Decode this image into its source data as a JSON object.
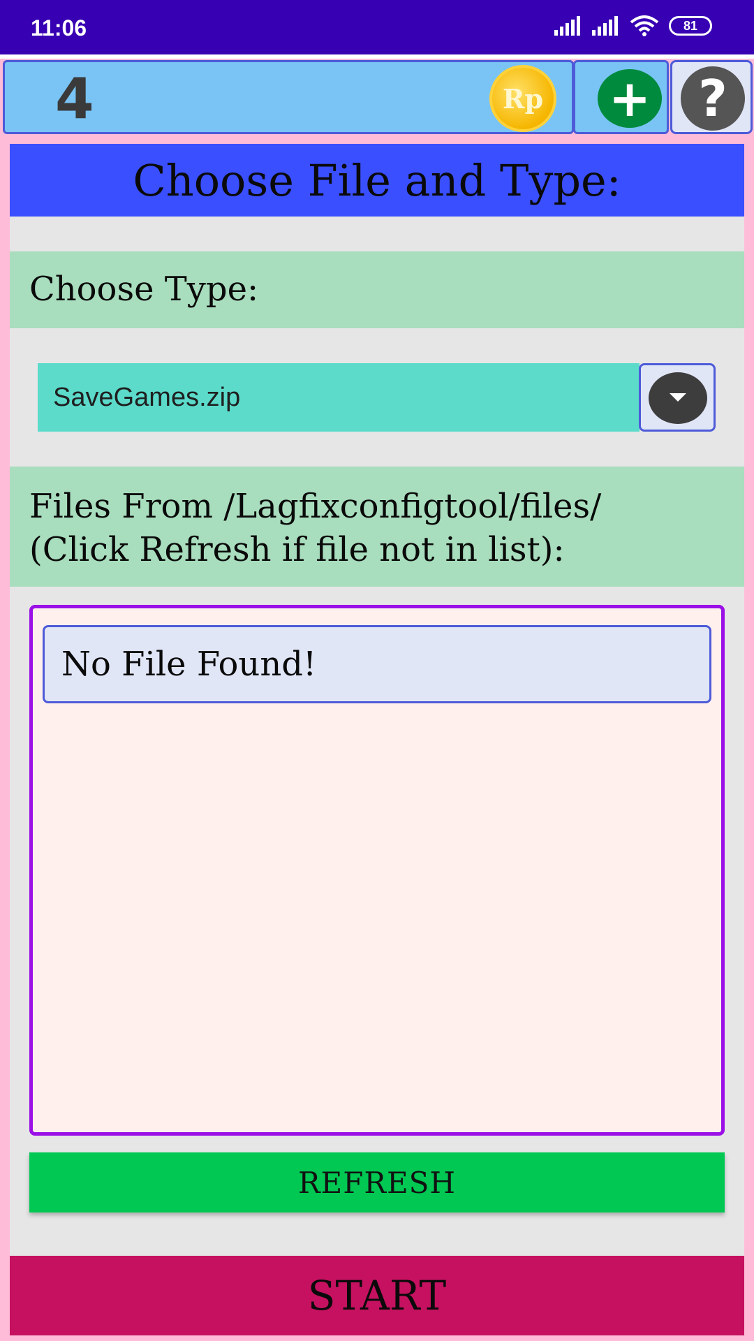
{
  "status_bar": {
    "time": "11:06",
    "battery": "81",
    "icons": [
      "signal-icon",
      "signal-icon",
      "wifi-icon",
      "battery-icon"
    ]
  },
  "topbar": {
    "points": "4",
    "coin_label": "Rp",
    "add_icon": "plus-icon",
    "help_icon": "question-icon"
  },
  "main": {
    "title": "Choose File and Type:",
    "type_label": "Choose Type:",
    "type_selected": "SaveGames.zip",
    "files_label_line1": "Files From /Lagfixconfigtool/files/",
    "files_label_line2": "(Click Refresh if file not in list):",
    "file_items": [
      "No File Found!"
    ],
    "refresh_label": "REFRESH",
    "start_label": "START"
  },
  "colors": {
    "status_bar": "#3700b3",
    "title_band": "#3a4fff",
    "label_band": "#a8ddbd",
    "dropdown": "#5cdbcb",
    "refresh": "#00c853",
    "start": "#c51160",
    "list_border": "#9a10e6"
  }
}
